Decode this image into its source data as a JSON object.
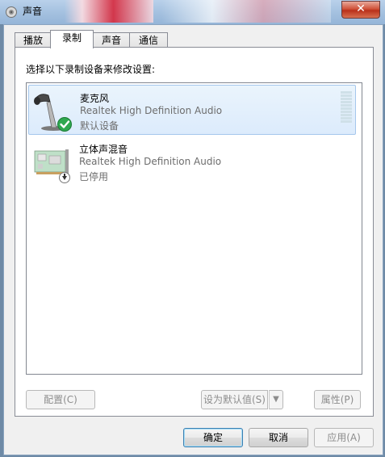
{
  "window": {
    "title": "声音",
    "close_label": "✕"
  },
  "tabs": [
    {
      "label": "播放",
      "active": false
    },
    {
      "label": "录制",
      "active": true
    },
    {
      "label": "声音",
      "active": false
    },
    {
      "label": "通信",
      "active": false
    }
  ],
  "panel": {
    "instruction": "选择以下录制设备来修改设置:",
    "devices": [
      {
        "name": "麦克风",
        "driver": "Realtek High Definition Audio",
        "status": "默认设备",
        "selected": true,
        "icon": "microphone-icon",
        "badge": "default-checkmark-icon"
      },
      {
        "name": "立体声混音",
        "driver": "Realtek High Definition Audio",
        "status": "已停用",
        "selected": false,
        "icon": "sound-card-icon",
        "badge": "disabled-arrow-icon"
      }
    ],
    "buttons": {
      "configure": "配置(C)",
      "set_default": "设为默认值(S)",
      "set_default_arrow": "▼",
      "properties": "属性(P)"
    }
  },
  "footer": {
    "ok": "确定",
    "cancel": "取消",
    "apply": "应用(A)"
  },
  "colors": {
    "selection": "#dcebfc",
    "selection_border": "#a5c7ec",
    "check_green": "#2fa84f"
  }
}
